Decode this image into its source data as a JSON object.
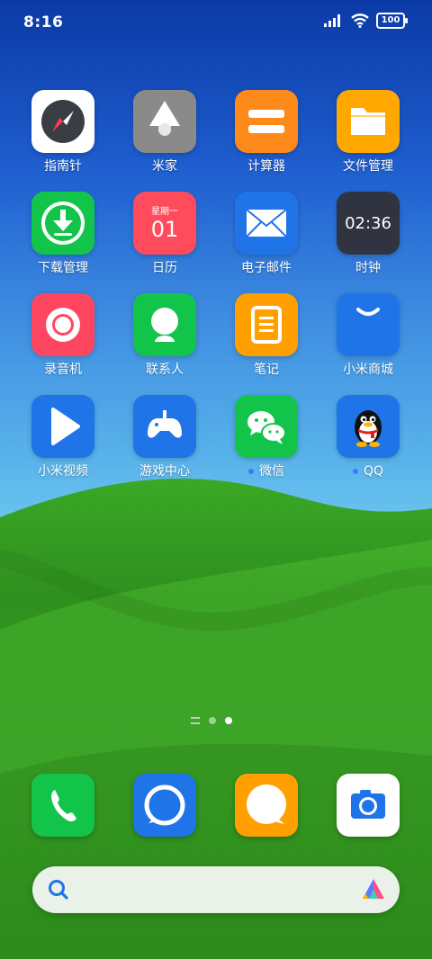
{
  "status_bar": {
    "time": "8:16",
    "battery": "100"
  },
  "apps": [
    {
      "label": "指南针",
      "icon": "compass-icon"
    },
    {
      "label": "米家",
      "icon": "mijia-icon"
    },
    {
      "label": "计算器",
      "icon": "calculator-icon"
    },
    {
      "label": "文件管理",
      "icon": "folder-icon"
    },
    {
      "label": "下载管理",
      "icon": "download-icon"
    },
    {
      "label": "日历",
      "icon": "calendar-icon",
      "weekday": "星期一",
      "day": "01"
    },
    {
      "label": "电子邮件",
      "icon": "mail-icon"
    },
    {
      "label": "时钟",
      "icon": "clock-icon",
      "time": "02:36"
    },
    {
      "label": "录音机",
      "icon": "recorder-icon"
    },
    {
      "label": "联系人",
      "icon": "contacts-icon"
    },
    {
      "label": "笔记",
      "icon": "notes-icon"
    },
    {
      "label": "小米商城",
      "icon": "shop-bag-icon"
    },
    {
      "label": "小米视频",
      "icon": "play-icon"
    },
    {
      "label": "游戏中心",
      "icon": "gamepad-icon"
    },
    {
      "label": "微信",
      "icon": "wechat-icon"
    },
    {
      "label": "QQ",
      "icon": "qq-penguin-icon"
    }
  ],
  "dock": [
    {
      "icon": "phone-icon"
    },
    {
      "icon": "browser-icon"
    },
    {
      "icon": "messages-icon"
    },
    {
      "icon": "camera-icon"
    }
  ],
  "colors": {
    "calculator": "#ff8a1c",
    "files": "#ffa800",
    "download": "#12c54a",
    "calendar": "#ff4b5c",
    "mail": "#1f74e8",
    "clock": "#2f3440",
    "recorder": "#ff4660",
    "contacts": "#12c54a",
    "notes": "#ffa000",
    "shop": "#1f74e8",
    "video": "#1f74e8",
    "game": "#1f74e8",
    "wechat": "#12c54a",
    "qq": "#1f74e8",
    "phone": "#12c54a",
    "browser": "#1f74e8",
    "messages": "#ffa000",
    "camera": "#ffffff"
  }
}
